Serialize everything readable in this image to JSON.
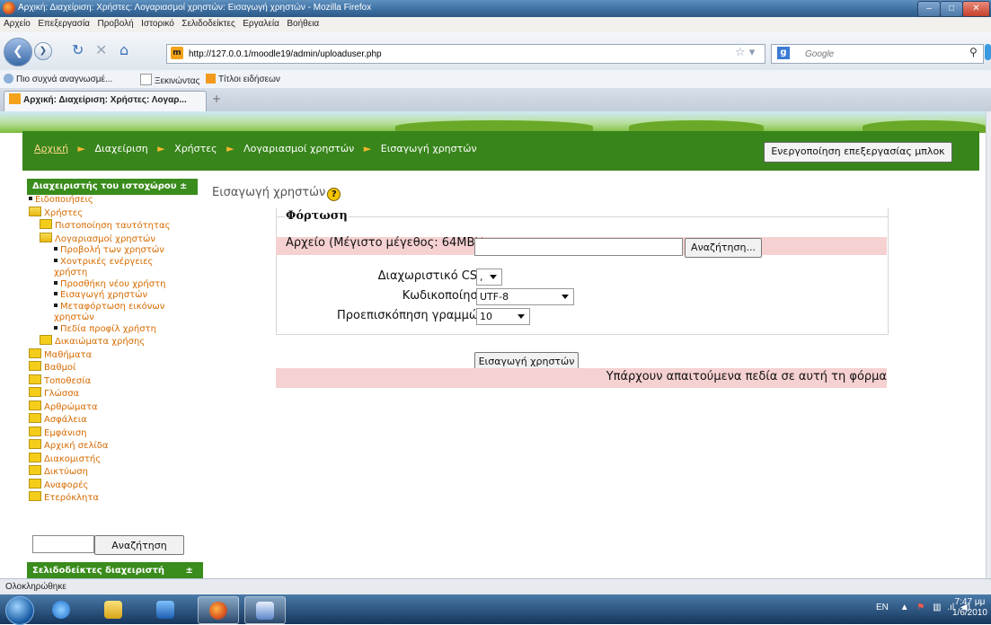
{
  "window": {
    "title": "Αρχική: Διαχείριση: Χρήστες: Λογαριασμοί χρηστών: Εισαγωγή χρηστών - Mozilla Firefox"
  },
  "menu": [
    "Αρχείο",
    "Επεξεργασία",
    "Προβολή",
    "Ιστορικό",
    "Σελιδοδείκτες",
    "Εργαλεία",
    "Βοήθεια"
  ],
  "browser": {
    "url": "http://127.0.0.1/moodle19/admin/uploaduser.php",
    "search_placeholder": "Google",
    "bookmarks": [
      "Πιο συχνά αναγνωσμέ...",
      "Ξεκινώντας",
      "Τίτλοι ειδήσεων"
    ],
    "tab_title": "Αρχική: Διαχείριση: Χρήστες: Λογαρ...",
    "status": "Ολοκληρώθηκε"
  },
  "breadcrumb": [
    "Αρχική",
    "Διαχείριση",
    "Χρήστες",
    "Λογαριασμοί χρηστών",
    "Εισαγωγή χρηστών"
  ],
  "edit_blocks_button": "Ενεργοποίηση επεξεργασίας μπλοκ",
  "sidebar": {
    "admin_title": "Διαχειριστής του ιστοχώρου",
    "tree": [
      {
        "label": "Ειδοποιήσεις",
        "kind": "bullet",
        "level": 0
      },
      {
        "label": "Χρήστες",
        "kind": "folder-open",
        "level": 0
      },
      {
        "label": "Πιστοποίηση ταυτότητας",
        "kind": "folder",
        "level": 1
      },
      {
        "label": "Λογαριασμοί χρηστών",
        "kind": "folder-open",
        "level": 1
      },
      {
        "label": "Προβολή των χρηστών",
        "kind": "bullet",
        "level": 2
      },
      {
        "label": "Χοντρικές ενέργειες χρήστη",
        "kind": "bullet",
        "level": 2
      },
      {
        "label": "Προσθήκη νέου χρήστη",
        "kind": "bullet",
        "level": 2
      },
      {
        "label": "Εισαγωγή χρηστών",
        "kind": "bullet",
        "level": 2
      },
      {
        "label": "Μεταφόρτωση εικόνων χρηστών",
        "kind": "bullet",
        "level": 2
      },
      {
        "label": "Πεδία προφίλ χρήστη",
        "kind": "bullet",
        "level": 2
      },
      {
        "label": "Δικαιώματα χρήσης",
        "kind": "folder",
        "level": 1
      },
      {
        "label": "Μαθήματα",
        "kind": "folder",
        "level": 0
      },
      {
        "label": "Βαθμοί",
        "kind": "folder",
        "level": 0
      },
      {
        "label": "Τοποθεσία",
        "kind": "folder",
        "level": 0
      },
      {
        "label": "Γλώσσα",
        "kind": "folder",
        "level": 0
      },
      {
        "label": "Αρθρώματα",
        "kind": "folder",
        "level": 0
      },
      {
        "label": "Ασφάλεια",
        "kind": "folder",
        "level": 0
      },
      {
        "label": "Εμφάνιση",
        "kind": "folder",
        "level": 0
      },
      {
        "label": "Αρχική σελίδα",
        "kind": "folder",
        "level": 0
      },
      {
        "label": "Διακομιστής",
        "kind": "folder",
        "level": 0
      },
      {
        "label": "Δικτύωση",
        "kind": "folder",
        "level": 0
      },
      {
        "label": "Αναφορές",
        "kind": "folder",
        "level": 0
      },
      {
        "label": "Ετερόκλητα",
        "kind": "folder",
        "level": 0
      }
    ],
    "search_button": "Αναζήτηση",
    "bookmarks_title": "Σελιδοδείκτες διαχειριστή"
  },
  "main": {
    "title": "Εισαγωγή χρηστών",
    "legend": "Φόρτωση",
    "file_label": "Αρχείο (Μέγιστο μέγεθος: 64MB)",
    "browse_button": "Αναζήτηση...",
    "csv_label": "Διαχωριστικό CSV",
    "csv_value": ",",
    "encoding_label": "Κωδικοποίηση",
    "encoding_value": "UTF-8",
    "preview_label": "Προεπισκόπηση γραμμών",
    "preview_value": "10",
    "submit_button": "Εισαγωγή χρηστών",
    "required_note": "Υπάρχουν απαιτούμενα πεδία σε αυτή τη φόρμα"
  },
  "taskbar": {
    "lang": "EN",
    "time": "7:47 μμ",
    "date": "1/6/2010"
  }
}
